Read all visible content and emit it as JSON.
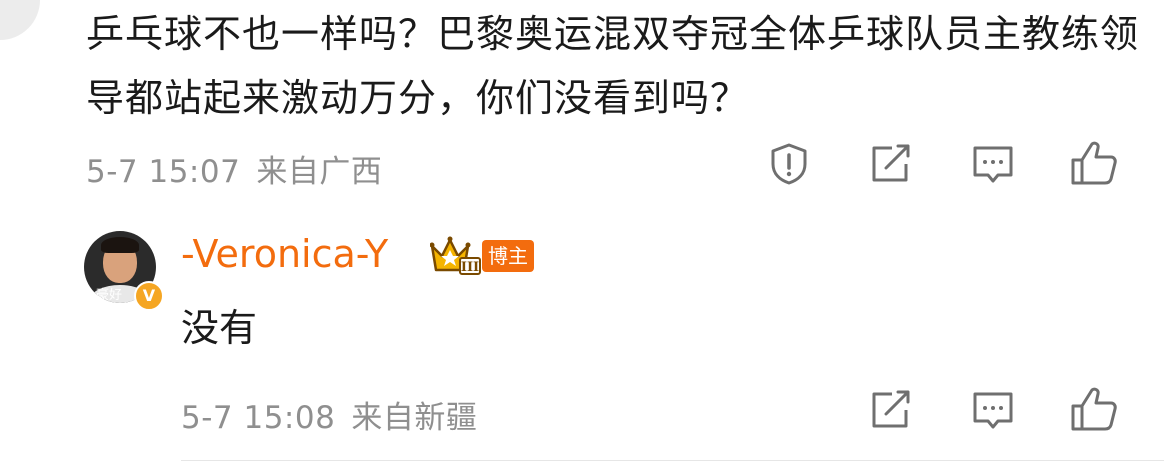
{
  "comment": {
    "text": "乒乓球不也一样吗？巴黎奥运混双夺冠全体乒球队员主教练领导都站起来激动万分，你们没看到吗？",
    "time": "5-7 15:07",
    "location": "来自广西",
    "icons": [
      "report-icon",
      "forward-icon",
      "comment-icon",
      "like-icon"
    ]
  },
  "reply": {
    "avatar_caption": "豪好",
    "verified_mark": "V",
    "username": "-Veronica-Y",
    "badge_level": "III",
    "tag": "博主",
    "text": "没有",
    "time": "5-7 15:08",
    "location": "来自新疆",
    "icons": [
      "forward-icon",
      "comment-icon",
      "like-icon"
    ]
  },
  "colors": {
    "username": "#f36c0e",
    "tag_bg": "#f36c0e",
    "meta": "#8f8f8f",
    "crown": "#f5b400"
  }
}
